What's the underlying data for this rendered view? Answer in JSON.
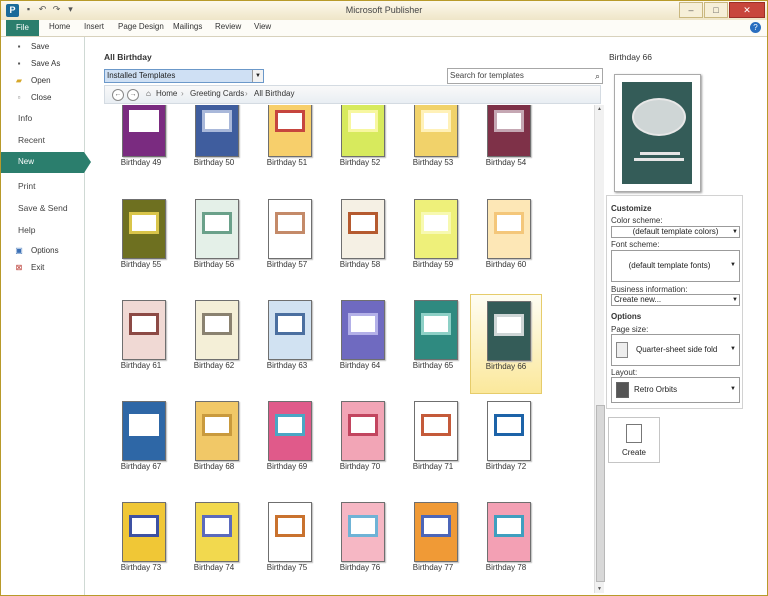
{
  "window": {
    "title": "Microsoft Publisher"
  },
  "ribbon": {
    "tabs": [
      "File",
      "Home",
      "Insert",
      "Page Design",
      "Mailings",
      "Review",
      "View"
    ]
  },
  "nav": {
    "save": "Save",
    "save_as": "Save As",
    "open": "Open",
    "close": "Close",
    "info": "Info",
    "recent": "Recent",
    "new": "New",
    "print": "Print",
    "save_send": "Save & Send",
    "help": "Help",
    "options": "Options",
    "exit": "Exit"
  },
  "main": {
    "title": "All Birthday",
    "dropdown": "Installed Templates",
    "search_placeholder": "Search for templates",
    "breadcrumb": {
      "home": "Home",
      "cat": "Greeting Cards",
      "cur": "All Birthday"
    }
  },
  "templates": [
    {
      "name": "Birthday 49",
      "colors": [
        "#7a2b80",
        "#ffffff"
      ]
    },
    {
      "name": "Birthday 50",
      "colors": [
        "#3f5d9e",
        "#a9b8da"
      ]
    },
    {
      "name": "Birthday 51",
      "colors": [
        "#f7cf6b",
        "#c6453e"
      ]
    },
    {
      "name": "Birthday 52",
      "colors": [
        "#d7ea5d",
        "#f7f7a0"
      ]
    },
    {
      "name": "Birthday 53",
      "colors": [
        "#f1d26a",
        "#fff1b8"
      ]
    },
    {
      "name": "Birthday 54",
      "colors": [
        "#7e3148",
        "#c5a7b3"
      ]
    },
    {
      "name": "Birthday 55",
      "colors": [
        "#6e7020",
        "#d9c54a"
      ]
    },
    {
      "name": "Birthday 56",
      "colors": [
        "#e4f0e8",
        "#6aa18a"
      ]
    },
    {
      "name": "Birthday 57",
      "colors": [
        "#ffffff",
        "#c48a69"
      ]
    },
    {
      "name": "Birthday 58",
      "colors": [
        "#f5f0e4",
        "#b55a2f"
      ]
    },
    {
      "name": "Birthday 59",
      "colors": [
        "#eef07a",
        "#f7f9b0"
      ]
    },
    {
      "name": "Birthday 60",
      "colors": [
        "#fde7b6",
        "#f4c77a"
      ]
    },
    {
      "name": "Birthday 61",
      "colors": [
        "#f0d9d4",
        "#8c4a45"
      ]
    },
    {
      "name": "Birthday 62",
      "colors": [
        "#f4efd7",
        "#8a8270"
      ]
    },
    {
      "name": "Birthday 63",
      "colors": [
        "#d1e2f2",
        "#4b6fa0"
      ]
    },
    {
      "name": "Birthday 64",
      "colors": [
        "#6f6ac0",
        "#b3b0e8"
      ]
    },
    {
      "name": "Birthday 65",
      "colors": [
        "#2f8a80",
        "#8dd0c6"
      ]
    },
    {
      "name": "Birthday 66",
      "colors": [
        "#345c58",
        "#cfd6d6"
      ]
    },
    {
      "name": "Birthday 67",
      "colors": [
        "#2e67a6",
        "#ffffff"
      ]
    },
    {
      "name": "Birthday 68",
      "colors": [
        "#f1c867",
        "#c99a3d"
      ]
    },
    {
      "name": "Birthday 69",
      "colors": [
        "#e05a8a",
        "#4aa6c4"
      ]
    },
    {
      "name": "Birthday 70",
      "colors": [
        "#f2a5b6",
        "#c2455f"
      ]
    },
    {
      "name": "Birthday 71",
      "colors": [
        "#ffffff",
        "#c45a3a"
      ]
    },
    {
      "name": "Birthday 72",
      "colors": [
        "#ffffff",
        "#1d63a8"
      ]
    },
    {
      "name": "Birthday 73",
      "colors": [
        "#f0c736",
        "#3d51a3"
      ]
    },
    {
      "name": "Birthday 74",
      "colors": [
        "#f2d94e",
        "#5b6abd"
      ]
    },
    {
      "name": "Birthday 75",
      "colors": [
        "#ffffff",
        "#c9722e"
      ]
    },
    {
      "name": "Birthday 76",
      "colors": [
        "#f6b7c4",
        "#6fb3d6"
      ]
    },
    {
      "name": "Birthday 77",
      "colors": [
        "#f09a36",
        "#4c66b8"
      ]
    },
    {
      "name": "Birthday 78",
      "colors": [
        "#f3a0b4",
        "#3f9fbf"
      ]
    }
  ],
  "right": {
    "selected_title": "Birthday 66",
    "customize": "Customize",
    "color_scheme_label": "Color scheme:",
    "color_scheme_value": "(default template colors)",
    "font_scheme_label": "Font scheme:",
    "font_scheme_value": "(default template fonts)",
    "business_label": "Business information:",
    "business_value": "Create new...",
    "options": "Options",
    "page_size_label": "Page size:",
    "page_size_value": "Quarter-sheet side fold",
    "layout_label": "Layout:",
    "layout_value": "Retro Orbits",
    "create": "Create"
  }
}
